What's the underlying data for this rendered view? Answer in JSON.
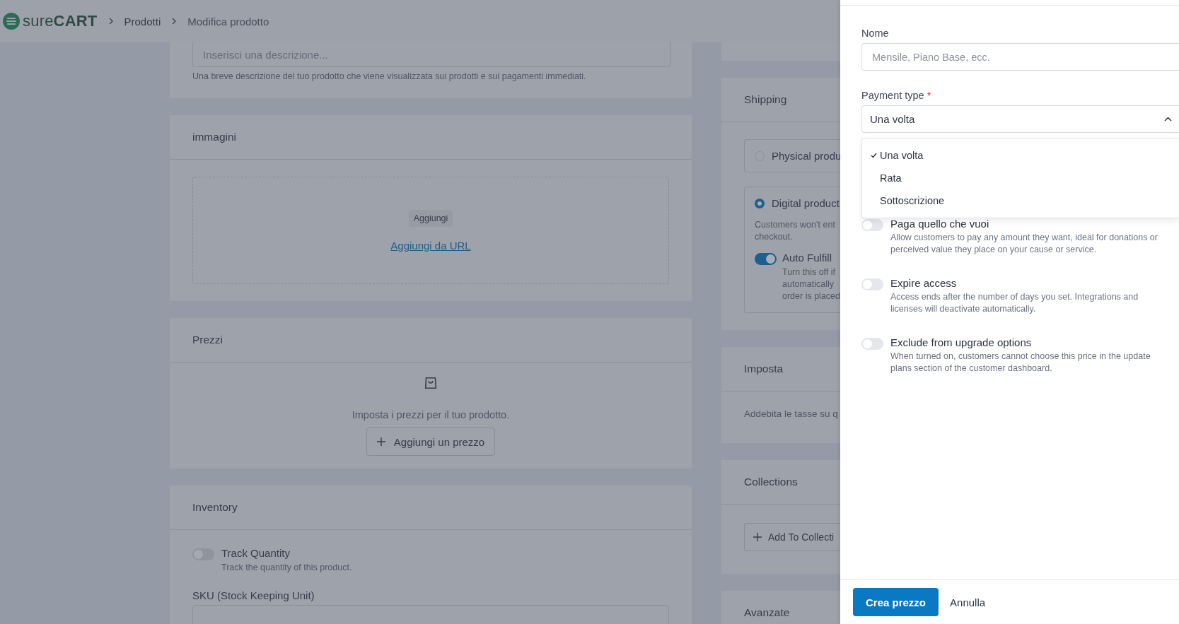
{
  "header": {
    "logo": "sure**CART**",
    "breadcrumbs": [
      "Prodotti",
      "Modifica prodotto"
    ]
  },
  "left_cards": {
    "description": {
      "placeholder": "Inserisci una descrizione...",
      "help": "Una breve descrizione del tuo prodotto che viene visualizzata sui prodotti e sui pagamenti immediati."
    },
    "images": {
      "title": "immagini",
      "add_button": "Aggiungi",
      "url_link": "Aggiungi da URL"
    },
    "prices": {
      "title": "Prezzi",
      "empty_text": "Imposta i prezzi per il tuo prodotto.",
      "add_button": "Aggiungi un prezzo"
    },
    "inventory": {
      "title": "Inventory",
      "toggles": [
        {
          "label": "Track Quantity",
          "description": "Track the quantity of this product.",
          "on": false
        }
      ],
      "sku_label": "SKU (Stock Keeping Unit)"
    }
  },
  "right_cards": {
    "shipping": {
      "title": "Shipping",
      "options": [
        {
          "label": "Physical produ",
          "selected": false
        },
        {
          "label": "Digital product",
          "selected": true,
          "description_lines": [
            "Customers won’t ent",
            "checkout."
          ],
          "auto_fulfill": {
            "label": "Auto Fulfill",
            "on": true,
            "description_lines": [
              "Turn this off if",
              "automatically",
              "order is placed"
            ]
          }
        }
      ]
    },
    "tax": {
      "title": "Imposta",
      "text": "Addebita le tasse su q"
    },
    "collections": {
      "title": "Collections",
      "add_button": "Add To Collecti"
    },
    "advanced": {
      "title": "Avanzate"
    }
  },
  "drawer": {
    "name_field": {
      "label": "Nome",
      "placeholder": "Mensile, Piano Base, ecc."
    },
    "payment_type": {
      "label": "Payment type",
      "required_mark": "*",
      "value": "Una volta",
      "expanded": true,
      "options": [
        {
          "label": "Una volta",
          "selected": true
        },
        {
          "label": "Rata",
          "selected": false
        },
        {
          "label": "Sottoscrizione",
          "selected": false
        }
      ]
    },
    "toggles": [
      {
        "label": "Paga quello che vuoi",
        "description": "Allow customers to pay any amount they want, ideal for donations or perceived value they place on your cause or service.",
        "on": false
      },
      {
        "label": "Expire access",
        "description": "Access ends after the number of days you set. Integrations and licenses will deactivate automatically.",
        "on": false
      },
      {
        "label": "Exclude from upgrade options",
        "description": "When turned on, customers cannot choose this price in the update plans section of the customer dashboard.",
        "on": false
      }
    ],
    "buttons": [
      {
        "label": "Crea prezzo",
        "kind": "primary"
      },
      {
        "label": "Annulla",
        "kind": "text"
      }
    ]
  }
}
